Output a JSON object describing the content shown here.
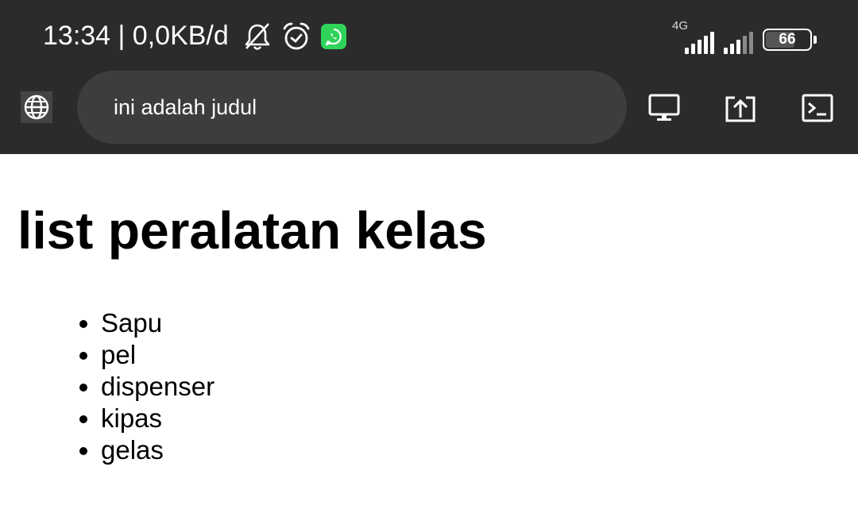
{
  "status_bar": {
    "time_text": "13:34 | 0,0KB/d",
    "network_label": "4G",
    "battery_level": "66",
    "battery_fraction": 0.66,
    "icons": [
      "bell-off-icon",
      "alarm-icon",
      "whatsapp-icon",
      "signal-icon",
      "signal-icon",
      "battery-icon"
    ]
  },
  "toolbar": {
    "url_text": "ini adalah judul",
    "icons": [
      "globe-icon",
      "desktop-icon",
      "share-icon",
      "terminal-icon"
    ]
  },
  "page": {
    "heading": "list peralatan kelas",
    "items": [
      "Sapu",
      "pel",
      "dispenser",
      "kipas",
      "gelas"
    ]
  },
  "colors": {
    "bar_background": "#2b2b2b",
    "url_field": "#3d3d3d",
    "whatsapp": "#2fd35a",
    "page_background": "#ffffff"
  }
}
